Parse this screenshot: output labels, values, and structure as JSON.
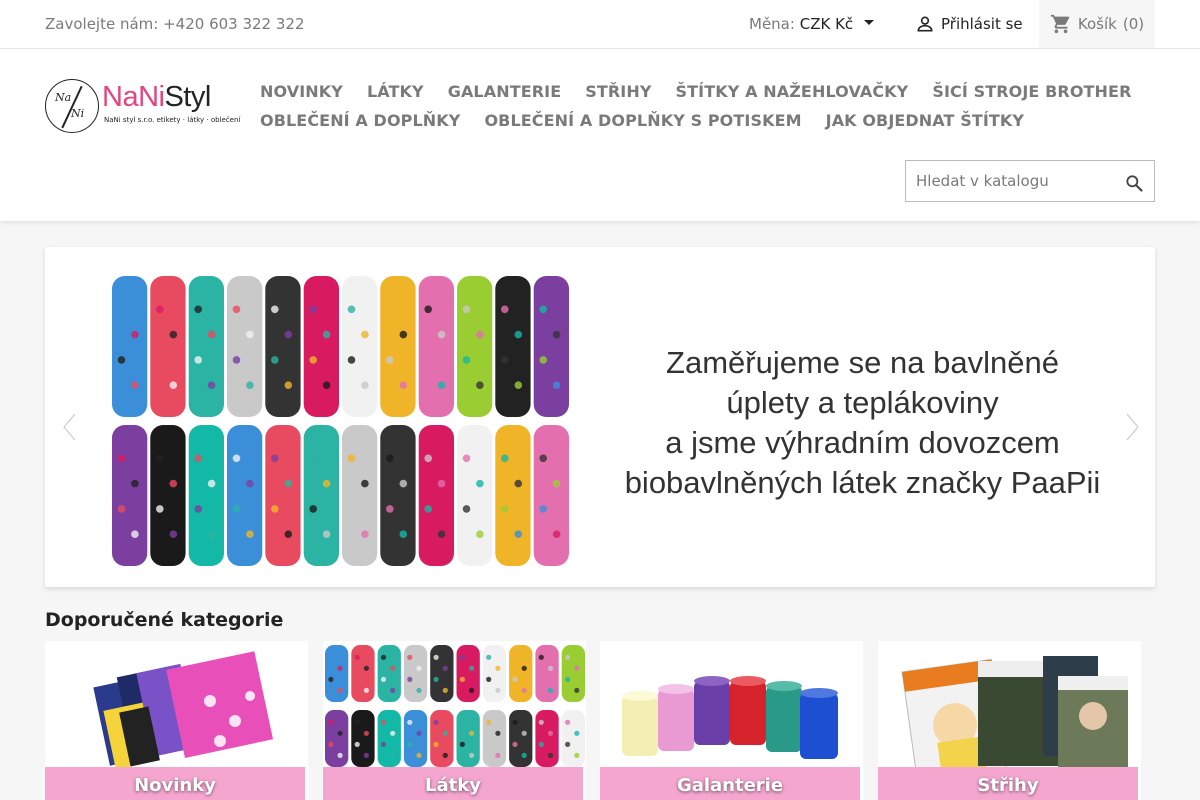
{
  "topbar": {
    "phone": "Zavolejte nám: +420 603 322 322",
    "currency_label": "Měna:",
    "currency_value": "CZK Kč",
    "login_label": "Přihlásit se",
    "cart_label": "Košík",
    "cart_count": "(0)"
  },
  "logo": {
    "brand_part1": "NaNi",
    "brand_part2": "Styl",
    "tagline": "NaNi styl s.r.o. etikety · látky · oblečení",
    "mark_a": "Na",
    "mark_b": "Ni"
  },
  "menu": {
    "row1": [
      "NOVINKY",
      "LÁTKY",
      "GALANTERIE",
      "STŘIHY",
      "ŠTÍTKY A NAŽEHLOVAČKY",
      "ŠICÍ STROJE BROTHER"
    ],
    "row2": [
      "OBLEČENÍ A DOPLŇKY",
      "OBLEČENÍ A DOPLŇKY S POTISKEM",
      "JAK OBJEDNAT ŠTÍTKY"
    ]
  },
  "search": {
    "placeholder": "Hledat v katalogu"
  },
  "slider": {
    "caption_lines": [
      "Zaměřujeme se na bavlněné",
      "úplety a teplákoviny",
      "a jsme výhradním dovozcem",
      "biobavlněných látek značky PaaPii"
    ]
  },
  "categories": {
    "title": "Doporučené kategorie",
    "items": [
      {
        "label": "Novinky"
      },
      {
        "label": "Látky"
      },
      {
        "label": "Galanterie"
      },
      {
        "label": "Střihy"
      }
    ]
  },
  "colors": {
    "brand_pink": "#e5457f",
    "category_bar": "#f4a6cf",
    "menu_text": "#7a7a7a"
  },
  "icons": {
    "login": "person-icon",
    "cart": "shopping-cart-icon",
    "search": "search-icon",
    "prev": "chevron-left-icon",
    "next": "chevron-right-icon"
  }
}
